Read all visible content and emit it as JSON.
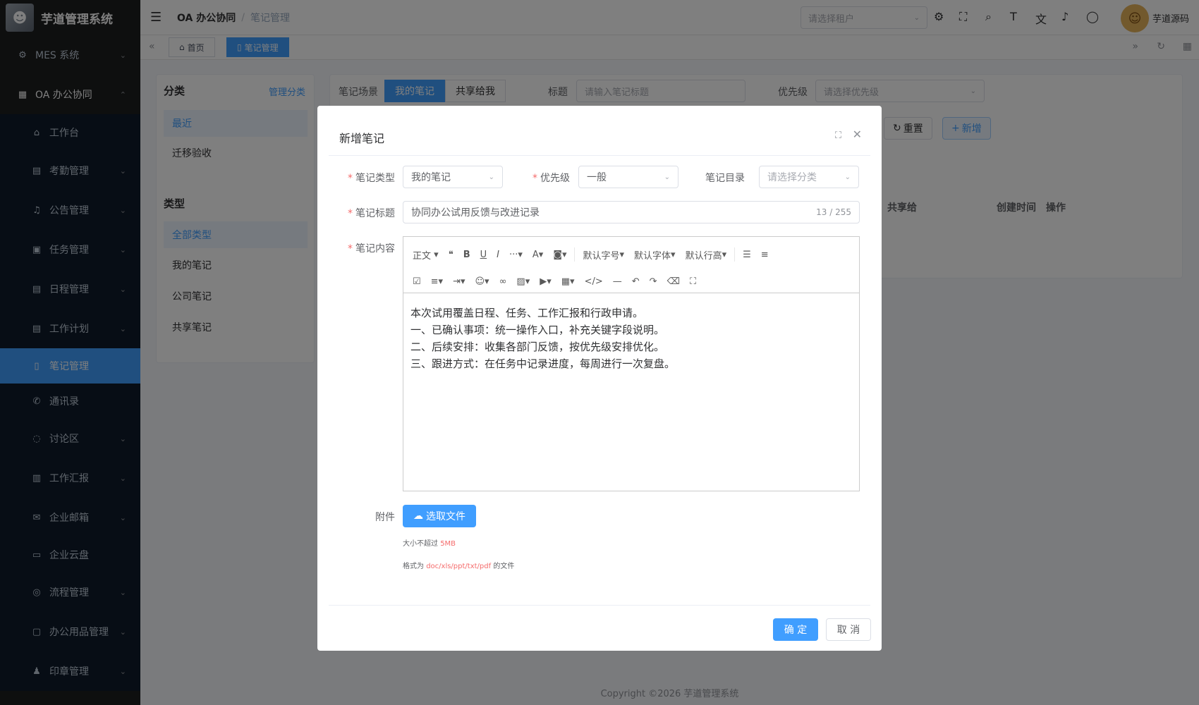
{
  "app": {
    "title": "芋道管理系统"
  },
  "sidebar": {
    "items": [
      {
        "label": "MES 系统",
        "icon": "gear-icon",
        "expandable": true
      },
      {
        "label": "OA 办公协同",
        "icon": "building-icon",
        "expandable": true,
        "open": true
      },
      {
        "label": "工作台",
        "icon": "home-icon",
        "expandable": false
      },
      {
        "label": "考勤管理",
        "icon": "calendar-icon",
        "expandable": true
      },
      {
        "label": "公告管理",
        "icon": "bell-icon",
        "expandable": true
      },
      {
        "label": "任务管理",
        "icon": "clipboard-icon",
        "expandable": true
      },
      {
        "label": "日程管理",
        "icon": "calendar-icon",
        "expandable": true
      },
      {
        "label": "工作计划",
        "icon": "calendar-icon",
        "expandable": true
      },
      {
        "label": "笔记管理",
        "icon": "notebook-icon",
        "expandable": false,
        "active": true
      },
      {
        "label": "通讯录",
        "icon": "phone-icon",
        "expandable": false
      },
      {
        "label": "讨论区",
        "icon": "chat-icon",
        "expandable": true
      },
      {
        "label": "工作汇报",
        "icon": "report-icon",
        "expandable": true
      },
      {
        "label": "企业邮箱",
        "icon": "mail-icon",
        "expandable": true
      },
      {
        "label": "企业云盘",
        "icon": "folder-icon",
        "expandable": false
      },
      {
        "label": "流程管理",
        "icon": "flow-icon",
        "expandable": true
      },
      {
        "label": "办公用品管理",
        "icon": "box-icon",
        "expandable": true
      },
      {
        "label": "印章管理",
        "icon": "stamp-icon",
        "expandable": true
      }
    ]
  },
  "header": {
    "breadcrumb": [
      "OA 办公协同",
      "笔记管理"
    ],
    "tenant_placeholder": "请选择租户",
    "user_name": "芋道源码"
  },
  "tags": {
    "home": "首页",
    "current": "笔记管理"
  },
  "categories": {
    "title": "分类",
    "manage_label": "管理分类",
    "items": [
      "最近",
      "迁移验收"
    ],
    "type_title": "类型",
    "types": [
      "全部类型",
      "我的笔记",
      "公司笔记",
      "共享笔记"
    ]
  },
  "query": {
    "scene_label": "笔记场景",
    "scene_options": [
      "我的笔记",
      "共享给我"
    ],
    "title_label": "标题",
    "title_placeholder": "请输入笔记标题",
    "priority_label": "优先级",
    "priority_placeholder": "请选择优先级",
    "reset_label": "重置",
    "add_label": "新增",
    "columns": [
      "共享给",
      "创建时间",
      "操作"
    ]
  },
  "footer": {
    "copyright": "Copyright ©2026 芋道管理系统"
  },
  "dialog": {
    "title": "新增笔记",
    "type_label": "笔记类型",
    "type_value": "我的笔记",
    "priority_label": "优先级",
    "priority_value": "一般",
    "dir_label": "笔记目录",
    "dir_placeholder": "请选择分类",
    "title_label": "笔记标题",
    "title_value": "协同办公试用反馈与改进记录",
    "title_count": "13 / 255",
    "content_label": "笔记内容",
    "toolbar": {
      "paragraph": "正文",
      "font_size": "默认字号",
      "font_family": "默认字体",
      "line_height": "默认行高"
    },
    "content_lines": [
      "本次试用覆盖日程、任务、工作汇报和行政申请。",
      "一、已确认事项：统一操作入口，补充关键字段说明。",
      "二、后续安排：收集各部门反馈，按优先级安排优化。",
      "三、跟进方式：在任务中记录进度，每周进行一次复盘。"
    ],
    "attach_label": "附件",
    "attach_button": "选取文件",
    "tip_size_prefix": "大小不超过",
    "tip_size_value": "5MB",
    "tip_format_prefix": "格式为",
    "tip_format_value": "doc/xls/ppt/txt/pdf",
    "tip_format_suffix": "的文件",
    "confirm_label": "确 定",
    "cancel_label": "取 消"
  },
  "colors": {
    "primary": "#409eff",
    "sidebar_bg": "#1d1e1f",
    "danger": "#f56c6c"
  }
}
